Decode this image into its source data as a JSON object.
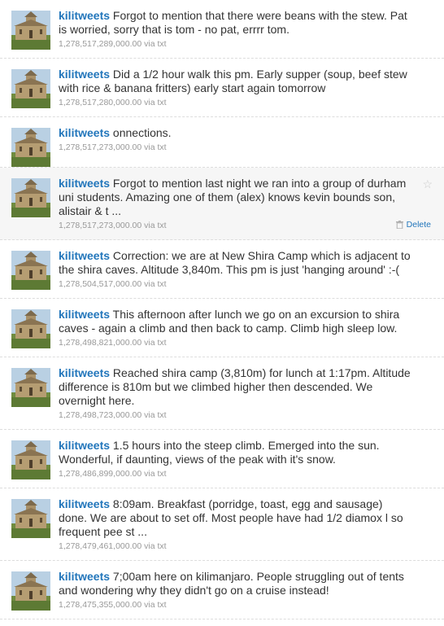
{
  "user": {
    "screen_name": "kilitweets"
  },
  "tweets": [
    {
      "text": "Forgot to mention that there were beans with the stew. Pat is worried, sorry that is tom - no pat, errrr tom.",
      "timestamp": "1,278,517,289,000.00",
      "source": "via txt"
    },
    {
      "text": "Did a 1/2 hour walk this pm. Early supper (soup, beef stew with rice & banana fritters) early start again tomorrow",
      "timestamp": "1,278,517,280,000.00",
      "source": "via txt"
    },
    {
      "text": "onnections.",
      "timestamp": "1,278,517,273,000.00",
      "source": "via txt"
    },
    {
      "text": "Forgot to mention last night we ran into a group of durham uni students. Amazing one of them (alex) knows kevin bounds son, alistair & t ...",
      "timestamp": "1,278,517,273,000.00",
      "source": "via txt",
      "favorite_icon": "star-outline-icon",
      "delete_label": "Delete"
    },
    {
      "text": "Correction: we are at New Shira Camp which is adjacent to the shira caves. Altitude 3,840m. This pm is just 'hanging around' :-(",
      "timestamp": "1,278,504,517,000.00",
      "source": "via txt"
    },
    {
      "text": "This afternoon after lunch we go on an excursion to shira caves - again a climb and then back to camp. Climb high sleep low.",
      "timestamp": "1,278,498,821,000.00",
      "source": "via txt"
    },
    {
      "text": "Reached shira camp (3,810m) for lunch at 1:17pm. Altitude difference is 810m but we climbed higher then descended. We overnight here.",
      "timestamp": "1,278,498,723,000.00",
      "source": "via txt"
    },
    {
      "text": "1.5 hours into the steep climb. Emerged into the sun. Wonderful, if daunting, views of the peak with it's snow.",
      "timestamp": "1,278,486,899,000.00",
      "source": "via txt"
    },
    {
      "text": "8:09am. Breakfast (porridge, toast, egg and sausage) done. We are about to set off. Most people have had 1/2 diamox l so frequent pee st ...",
      "timestamp": "1,278,479,461,000.00",
      "source": "via txt"
    },
    {
      "text": "7;00am here on kilimanjaro. People struggling out of tents and wondering why they didn't go on a cruise instead!",
      "timestamp": "1,278,475,355,000.00",
      "source": "via txt"
    }
  ],
  "colors": {
    "link": "#2276bb",
    "meta": "#999999",
    "hover_bg": "#f6f6f6",
    "divider": "#dddddd"
  }
}
